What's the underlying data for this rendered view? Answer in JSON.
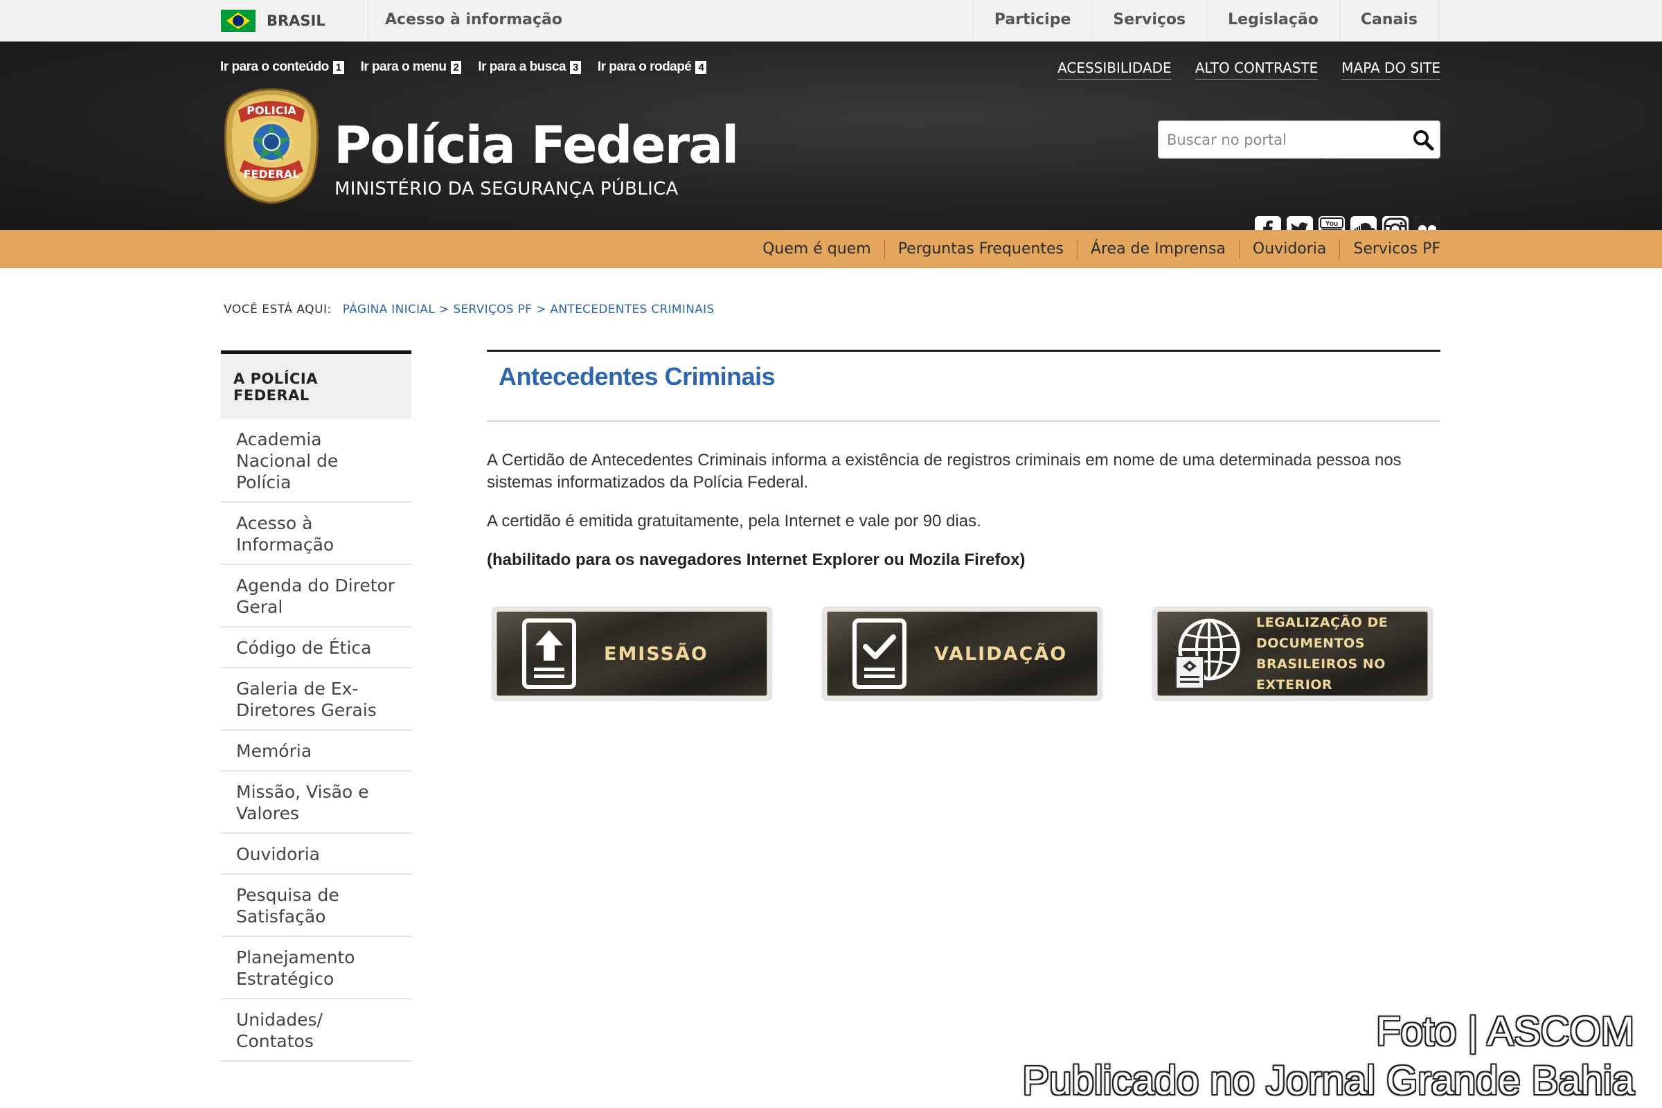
{
  "gov_bar": {
    "brasil_label": "BRASIL",
    "acesso_label": "Acesso à informação",
    "links": [
      "Participe",
      "Serviços",
      "Legislação",
      "Canais"
    ]
  },
  "header": {
    "skip_links": [
      {
        "label": "Ir para o conteúdo",
        "num": "1"
      },
      {
        "label": "Ir para o menu",
        "num": "2"
      },
      {
        "label": "Ir para a busca",
        "num": "3"
      },
      {
        "label": "Ir para o rodapé",
        "num": "4"
      }
    ],
    "util_links": [
      "ACESSIBILIDADE",
      "ALTO CONTRASTE",
      "MAPA DO SITE"
    ],
    "emblem_text_top": "POLICIA",
    "emblem_text_bottom": "FEDERAL",
    "title": "Polícia Federal",
    "subtitle": "MINISTÉRIO DA SEGURANÇA PÚBLICA",
    "search_placeholder": "Buscar no portal",
    "socials": [
      "facebook-icon",
      "twitter-icon",
      "youtube-icon",
      "soundcloud-icon",
      "instagram-icon",
      "flickr-icon"
    ],
    "youtube_text": "You Tube"
  },
  "orange_nav": [
    "Quem é quem",
    "Perguntas Frequentes",
    "Área de Imprensa",
    "Ouvidoria",
    "Servicos PF"
  ],
  "breadcrumb": {
    "label": "VOCÊ ESTÁ AQUI:",
    "items": [
      "PÁGINA INICIAL",
      "SERVIÇOS PF",
      "ANTECEDENTES CRIMINAIS"
    ],
    "separator": ">"
  },
  "sidebar": {
    "heading": "A POLÍCIA FEDERAL",
    "items": [
      "Academia Nacional de Polícia",
      "Acesso à Informação",
      "Agenda do Diretor Geral",
      "Código de Ética",
      "Galeria de Ex-Diretores Gerais",
      "Memória",
      "Missão, Visão e Valores",
      "Ouvidoria",
      "Pesquisa de Satisfação",
      "Planejamento Estratégico",
      "Unidades/ Contatos"
    ]
  },
  "main": {
    "title": "Antecedentes Criminais",
    "para1": "A Certidão de Antecedentes Criminais informa a existência de registros criminais em nome de uma determinada pessoa nos sistemas informatizados da Polícia Federal.",
    "para2": "A certidão é emitida gratuitamente, pela Internet e vale por 90 dias.",
    "para3": "(habilitado para os navegadores Internet Explorer ou Mozila Firefox)",
    "buttons": {
      "emissao": "EMISSÃO",
      "validacao": "VALIDAÇÃO",
      "legalizacao_line1": "LEGALIZAÇÃO DE DOCUMENTOS",
      "legalizacao_line2": "BRASILEIROS NO EXTERIOR"
    }
  },
  "watermark": {
    "line1": "Foto | ASCOM",
    "line2": "Publicado no Jornal Grande Bahia"
  },
  "colors": {
    "header_dark": "#1f1f1f",
    "orange_nav": "#e3a65d",
    "link_blue": "#2c66ae",
    "button_gold": "#f2d79a"
  }
}
